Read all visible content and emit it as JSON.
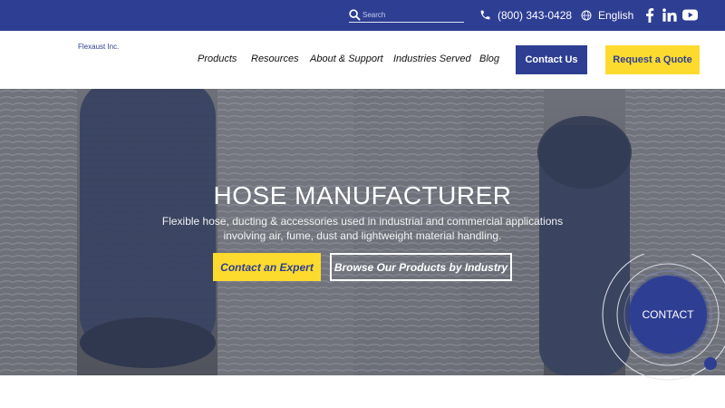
{
  "topbar": {
    "search_placeholder": "Search",
    "phone": "(800) 343-0428",
    "language": "English",
    "icons": [
      "search-icon",
      "phone-icon",
      "globe-icon",
      "facebook-icon",
      "linkedin-icon",
      "youtube-icon"
    ]
  },
  "header": {
    "logo_text": "Flexaust Inc.",
    "nav": [
      {
        "label": "Products"
      },
      {
        "label": "Resources"
      },
      {
        "label": "About & Support"
      },
      {
        "label": "Industries Served"
      },
      {
        "label": "Blog"
      }
    ],
    "contact_label": "Contact Us",
    "quote_label": "Request a Quote"
  },
  "hero": {
    "title": "HOSE MANUFACTURER",
    "subtitle_line1": "Flexible hose, ducting & accessories used in industrial and commercial applications",
    "subtitle_line2": "involving air, fume, dust and lightweight material handling.",
    "cta_expert": "Contact an Expert",
    "cta_browse": "Browse Our Products by Industry"
  },
  "widget": {
    "label": "CONTACT"
  },
  "colors": {
    "brand_blue": "#2e3e93",
    "accent_yellow": "#fddb2e"
  }
}
